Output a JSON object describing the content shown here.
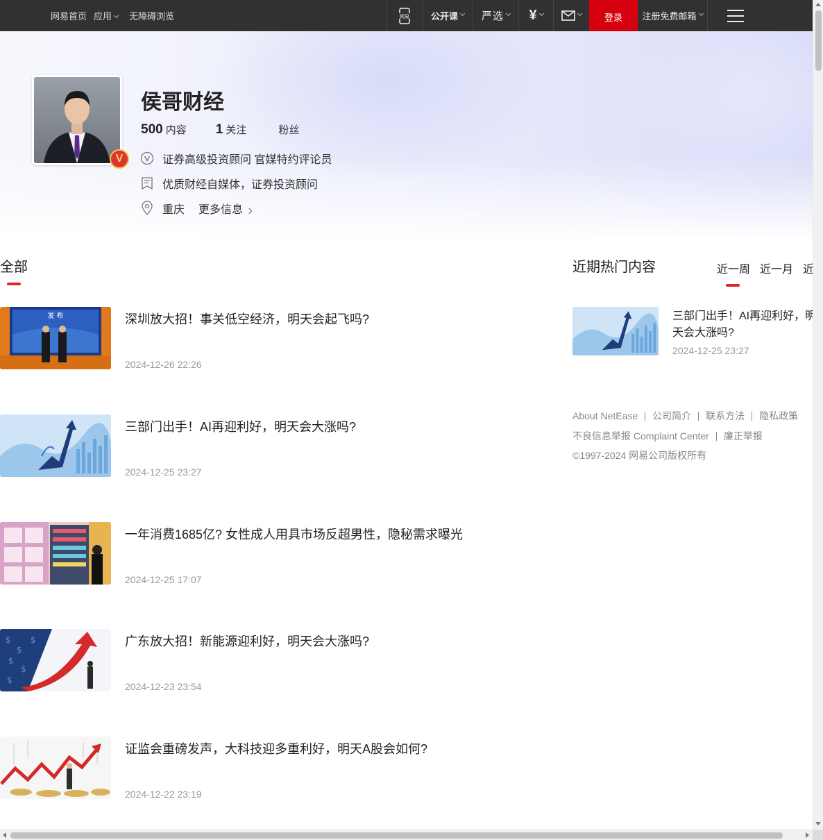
{
  "topbar": {
    "left_links": [
      "网易首页",
      "应用",
      "无障碍浏览"
    ],
    "right_items": [
      {
        "name": "mobile-app",
        "label": "网易"
      },
      {
        "name": "open-course",
        "label": "公开课"
      },
      {
        "name": "yanxuan",
        "label": "严选"
      },
      {
        "name": "payment",
        "label": "¥"
      },
      {
        "name": "mail",
        "label": ""
      }
    ],
    "login_label": "登录",
    "register_label": "注册免费邮箱"
  },
  "profile": {
    "name": "侯哥财经",
    "stats": [
      {
        "value": "500",
        "label": "内容"
      },
      {
        "value": "1",
        "label": "关注"
      },
      {
        "value": "",
        "label": "粉丝"
      }
    ],
    "verification": "证券高级投资顾问 官媒特约评论员",
    "description": "优质财经自媒体，证券投资顾问",
    "location": "重庆",
    "more_info_label": "更多信息"
  },
  "main": {
    "tab_label": "全部",
    "articles": [
      {
        "title": "深圳放大招！事关低空经济，明天会起飞吗?",
        "date": "2024-12-26 22:26"
      },
      {
        "title": "三部门出手！AI再迎利好，明天会大涨吗?",
        "date": "2024-12-25 23:27"
      },
      {
        "title": "一年消费1685亿? 女性成人用具市场反超男性，隐秘需求曝光",
        "date": "2024-12-25 17:07"
      },
      {
        "title": "广东放大招！新能源迎利好，明天会大涨吗?",
        "date": "2024-12-23 23:54"
      },
      {
        "title": "证监会重磅发声，大科技迎多重利好，明天A股会如何?",
        "date": "2024-12-22 23:19"
      }
    ]
  },
  "sidebar": {
    "hot_title": "近期热门内容",
    "tabs": [
      "近一周",
      "近一月",
      "近三月"
    ],
    "hot_item": {
      "title": "三部门出手！AI再迎利好，明天会大涨吗?",
      "date": "2024-12-25 23:27"
    },
    "footer_row1": [
      "About NetEase",
      "公司简介",
      "联系方法",
      "隐私政策"
    ],
    "footer_row2": [
      "不良信息举报 Complaint Center",
      "廉正举报"
    ],
    "copyright": "©1997-2024 网易公司版权所有"
  },
  "colors": {
    "accent": "#e0262f",
    "topbar": "#313131",
    "login": "#d7000f"
  }
}
